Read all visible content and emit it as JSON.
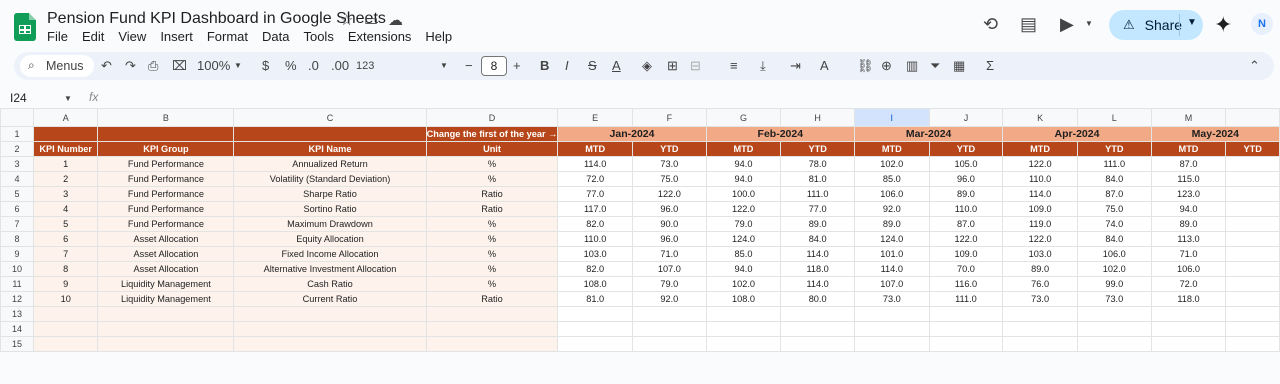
{
  "app": {
    "doc_title": "Pension Fund KPI Dashboard in Google Sheets",
    "menus": [
      "File",
      "Edit",
      "View",
      "Insert",
      "Format",
      "Data",
      "Tools",
      "Extensions",
      "Help"
    ],
    "share_label": "Share",
    "accent": "#c2e7ff",
    "brand_green": "#0f9d58"
  },
  "toolbar": {
    "menus_label": "Menus",
    "zoom": "100%",
    "currency": "$",
    "percent": "%",
    "dec_dec": ".0",
    "dec_inc": ".00",
    "number_fmt": "123",
    "font_size": "8"
  },
  "formula_bar": {
    "name_box": "I24",
    "fx": "fx"
  },
  "sheet": {
    "columns": [
      "A",
      "B",
      "C",
      "D",
      "E",
      "F",
      "G",
      "H",
      "I",
      "J",
      "K",
      "L",
      "M"
    ],
    "selected_column": "I",
    "row_numbers": [
      "1",
      "2",
      "3",
      "4",
      "5",
      "6",
      "7",
      "8",
      "9",
      "10",
      "11",
      "12",
      "13",
      "14",
      "15"
    ],
    "banner": "Change the first of the year →",
    "months": [
      "Jan-2024",
      "Feb-2024",
      "Mar-2024",
      "Apr-2024",
      "May-2024"
    ],
    "headers": [
      "KPI Number",
      "KPI Group",
      "KPI Name",
      "Unit"
    ],
    "mtd": "MTD",
    "ytd": "YTD",
    "rows": [
      {
        "num": "1",
        "group": "Fund Performance",
        "name": "Annualized Return",
        "unit": "%",
        "vals": [
          "114.0",
          "73.0",
          "94.0",
          "78.0",
          "102.0",
          "105.0",
          "122.0",
          "111.0",
          "87.0"
        ]
      },
      {
        "num": "2",
        "group": "Fund Performance",
        "name": "Volatility (Standard Deviation)",
        "unit": "%",
        "vals": [
          "72.0",
          "75.0",
          "94.0",
          "81.0",
          "85.0",
          "96.0",
          "110.0",
          "84.0",
          "115.0"
        ]
      },
      {
        "num": "3",
        "group": "Fund Performance",
        "name": "Sharpe Ratio",
        "unit": "Ratio",
        "vals": [
          "77.0",
          "122.0",
          "100.0",
          "111.0",
          "106.0",
          "89.0",
          "114.0",
          "87.0",
          "123.0"
        ]
      },
      {
        "num": "4",
        "group": "Fund Performance",
        "name": "Sortino Ratio",
        "unit": "Ratio",
        "vals": [
          "117.0",
          "96.0",
          "122.0",
          "77.0",
          "92.0",
          "110.0",
          "109.0",
          "75.0",
          "94.0"
        ]
      },
      {
        "num": "5",
        "group": "Fund Performance",
        "name": "Maximum Drawdown",
        "unit": "%",
        "vals": [
          "82.0",
          "90.0",
          "79.0",
          "89.0",
          "89.0",
          "87.0",
          "119.0",
          "74.0",
          "89.0"
        ]
      },
      {
        "num": "6",
        "group": "Asset Allocation",
        "name": "Equity Allocation",
        "unit": "%",
        "vals": [
          "110.0",
          "96.0",
          "124.0",
          "84.0",
          "124.0",
          "122.0",
          "122.0",
          "84.0",
          "113.0"
        ]
      },
      {
        "num": "7",
        "group": "Asset Allocation",
        "name": "Fixed Income Allocation",
        "unit": "%",
        "vals": [
          "103.0",
          "71.0",
          "85.0",
          "114.0",
          "101.0",
          "109.0",
          "103.0",
          "106.0",
          "71.0"
        ]
      },
      {
        "num": "8",
        "group": "Asset Allocation",
        "name": "Alternative Investment Allocation",
        "unit": "%",
        "vals": [
          "82.0",
          "107.0",
          "94.0",
          "118.0",
          "114.0",
          "70.0",
          "89.0",
          "102.0",
          "106.0"
        ]
      },
      {
        "num": "9",
        "group": "Liquidity Management",
        "name": "Cash Ratio",
        "unit": "%",
        "vals": [
          "108.0",
          "79.0",
          "102.0",
          "114.0",
          "107.0",
          "116.0",
          "76.0",
          "99.0",
          "72.0"
        ]
      },
      {
        "num": "10",
        "group": "Liquidity Management",
        "name": "Current Ratio",
        "unit": "Ratio",
        "vals": [
          "81.0",
          "92.0",
          "108.0",
          "80.0",
          "73.0",
          "111.0",
          "73.0",
          "73.0",
          "118.0"
        ]
      }
    ],
    "colors": {
      "dark_header": "#b7471a",
      "month_header": "#f2a985",
      "light_fill": "#fdf3ec"
    }
  }
}
